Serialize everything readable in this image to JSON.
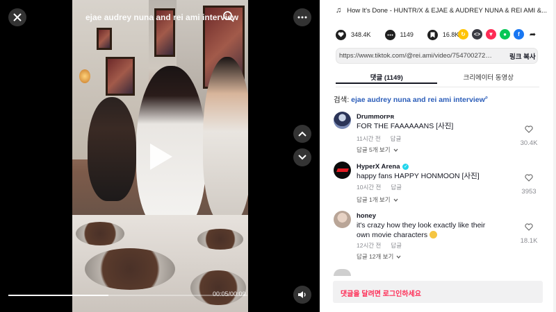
{
  "video": {
    "title": "ejae audrey nuna and rei ami interview",
    "time": "00:05/00:09",
    "progress_fraction": 0.42
  },
  "panel": {
    "song": "How It's Done - HUNTR/X & EJAE & AUDREY NUNA & REI AMI &...",
    "likes": "348.4K",
    "comments": "1149",
    "saves": "16.8K",
    "url": "https://www.tiktok.com/@rei.ami/video/754700272559...",
    "copy_label": "링크 복사",
    "tabs": [
      "댓글 (1149)",
      "크리에이터 동영상"
    ],
    "search_prefix": "검색:",
    "search_keyword": "ejae audrey nuna and rei ami interview",
    "login_prompt": "댓글을 달려면 로그인하세요"
  },
  "comments": [
    {
      "name": "Drummorᴘʀ",
      "text": "FOR THE FAAAAAANS [사진]",
      "time": "11시간 전",
      "reply_label": "답글",
      "replies": "답글 5개 보기",
      "likes": "30.4K"
    },
    {
      "name": "HyperX Arena",
      "text": "happy fans HAPPY HONMOON [사진]",
      "time": "10시간 전",
      "reply_label": "답글",
      "replies": "답글 1개 보기",
      "likes": "3953"
    },
    {
      "name": "honey",
      "text": "it's crazy how they look exactly like their own movie characters",
      "time": "12시간 전",
      "reply_label": "답글",
      "replies": "답글 12개 보기",
      "likes": "18.1K"
    }
  ],
  "colors": {
    "accent_red": "#fe2c55",
    "link_blue": "#2b5db9",
    "verified": "#20d5ec"
  }
}
